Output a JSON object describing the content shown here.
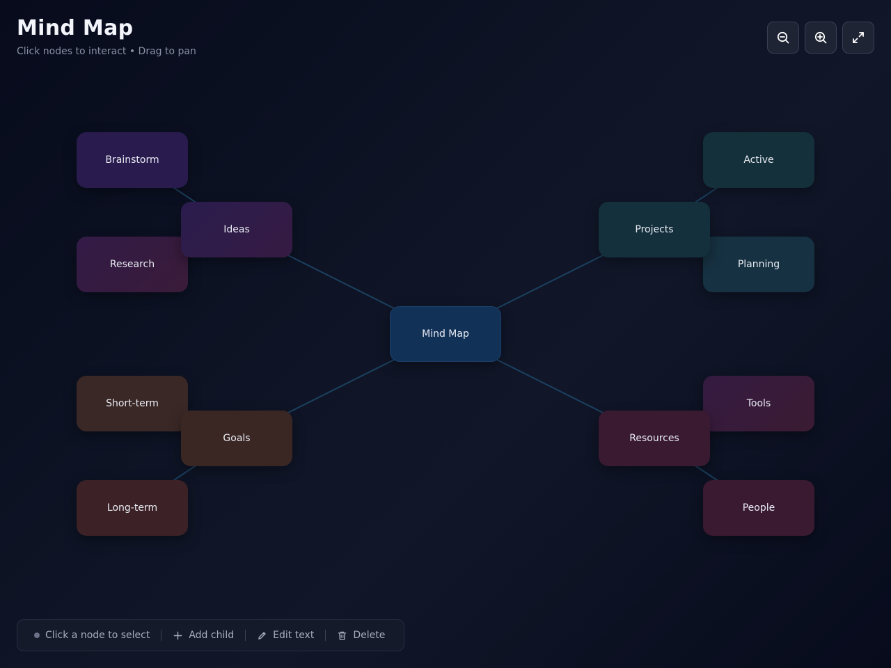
{
  "header": {
    "title": "Mind Map",
    "subtitle": "Click nodes to interact • Drag to pan"
  },
  "controls": {
    "zoom_out_icon": "zoom-out-icon",
    "zoom_in_icon": "zoom-in-icon",
    "fit_icon": "expand-icon"
  },
  "nodes": {
    "center": "Mind Map",
    "ideas": "Ideas",
    "brainstorm": "Brainstorm",
    "research": "Research",
    "projects": "Projects",
    "active": "Active",
    "planning": "Planning",
    "goals": "Goals",
    "shortterm": "Short-term",
    "longterm": "Long-term",
    "resources": "Resources",
    "tools": "Tools",
    "people": "People"
  },
  "toolbar": {
    "status": "Click a node to select",
    "add_child": "Add child",
    "edit_text": "Edit text",
    "delete": "Delete"
  },
  "colors": {
    "edge": "#1e4868",
    "center_node": "#123157",
    "ideas_branch": "#2a1b4f",
    "projects_branch": "#14303c",
    "goals_branch": "#3a2724",
    "resources_branch": "#3a1a31"
  }
}
